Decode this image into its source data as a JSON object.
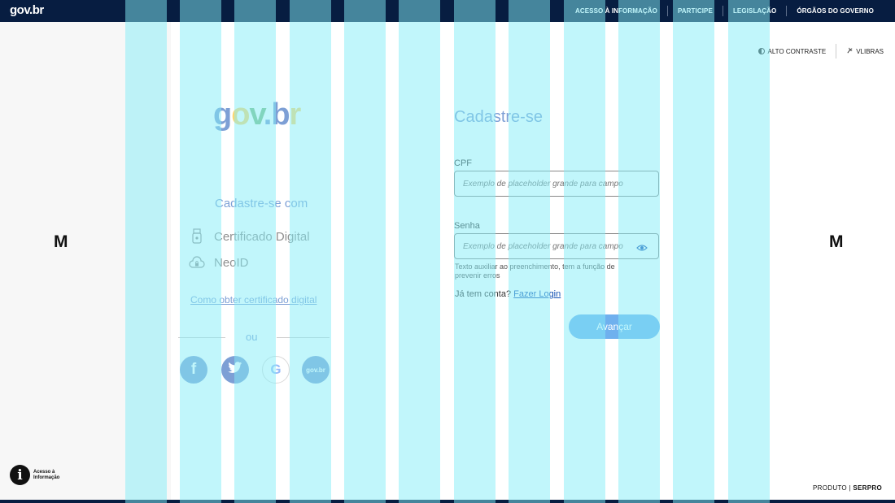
{
  "topbar": {
    "logo": "gov.br",
    "links": [
      "ACESSO À INFORMAÇÃO",
      "PARTICIPE",
      "LEGISLAÇÃO",
      "ÓRGÃOS DO GOVERNO"
    ]
  },
  "accessibility": {
    "contrast_label": "ALTO CONTRASTE",
    "vlibras_label": "VLIBRAS"
  },
  "side_letters": {
    "left": "M",
    "right": "M"
  },
  "brand": {
    "g": "g",
    "o": "o",
    "v": "v",
    "dot": ".",
    "b": "b",
    "r": "r"
  },
  "left_panel": {
    "title": "Cadastre-se com",
    "options": [
      {
        "label": "Certificado Digital",
        "icon": "usb-token-icon"
      },
      {
        "label": "NeoID",
        "icon": "cloud-lock-icon"
      }
    ],
    "cert_link": "Como obter certificado digital",
    "or_label": "ou",
    "social": [
      {
        "name": "facebook",
        "glyph": "f",
        "color": "#1877f2"
      },
      {
        "name": "twitter",
        "glyph": "t",
        "color": "#1d9bf0"
      },
      {
        "name": "google",
        "glyph": "G",
        "color": "#ffffff"
      },
      {
        "name": "govbr",
        "glyph": "gov.br",
        "color": "#1351b4"
      }
    ]
  },
  "form": {
    "title": "Cadastre-se",
    "cpf_label": "CPF",
    "cpf_placeholder": "Exemplo de placeholder grande para campo",
    "password_label": "Senha",
    "password_placeholder": "Exemplo de placeholder grande para campo",
    "helper_text": "Texto auxiliar ao preenchimento, tem a função de prevenir erros",
    "login_prompt": "Já tem conta?",
    "login_link": "Fazer Login",
    "submit_label": "Avançar"
  },
  "footer": {
    "access_info": "Acesso à Informação",
    "product_prefix": "PRODUTO",
    "product_brand": "SERPRO"
  },
  "colors": {
    "navy": "#071d41",
    "primary": "#1351b4",
    "button": "#6fb0ee",
    "overlay": "#84eef7"
  }
}
